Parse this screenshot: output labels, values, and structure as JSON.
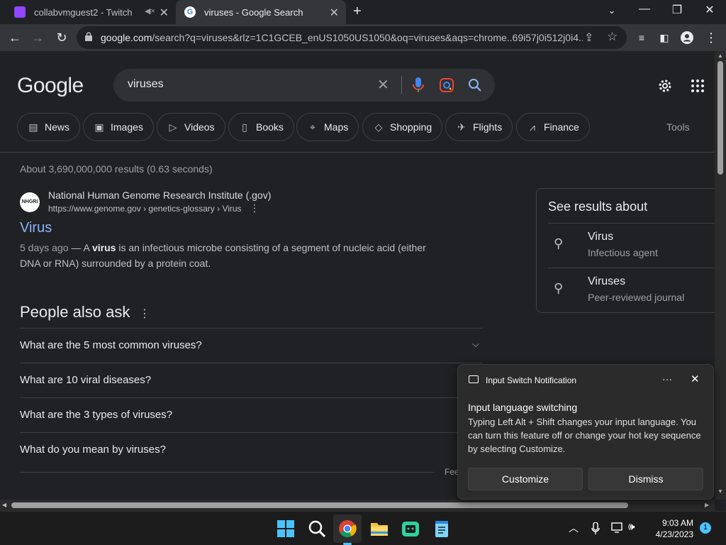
{
  "browser": {
    "tabs": [
      {
        "title": "collabvmguest2 - Twitch",
        "active": false
      },
      {
        "title": "viruses - Google Search",
        "active": true
      }
    ],
    "new_tab_icon": "plus-icon",
    "address": "google.com/search?q=viruses&rlz=1C1GCEB_enUS1050US1050&oq=viruses&aqs=chrome..69i57j0i512j0i4...",
    "address_domain": "google.com",
    "address_path": "/search?q=viruses&rlz=1C1GCEB_enUS1050US1050&oq=viruses&aqs=chrome..69i57j0i512j0i4..."
  },
  "google": {
    "logo": "Google",
    "query": "viruses",
    "chips": [
      {
        "label": "News",
        "icon": "news-icon"
      },
      {
        "label": "Images",
        "icon": "image-icon"
      },
      {
        "label": "Videos",
        "icon": "video-icon"
      },
      {
        "label": "Books",
        "icon": "book-icon"
      },
      {
        "label": "Maps",
        "icon": "map-pin-icon"
      },
      {
        "label": "Shopping",
        "icon": "tag-icon"
      },
      {
        "label": "Flights",
        "icon": "plane-icon"
      },
      {
        "label": "Finance",
        "icon": "finance-icon"
      }
    ],
    "tools": "Tools",
    "stats": "About 3,690,000,000 results (0.63 seconds)",
    "result": {
      "site": "National Human Genome Research Institute (.gov)",
      "url": "https://www.genome.gov › genetics-glossary › Virus",
      "title": "Virus",
      "date": "5 days ago",
      "snippet_pre": " — A ",
      "snippet_bold": "virus",
      "snippet_post": " is an infectious microbe consisting of a segment of nucleic acid (either DNA or RNA) surrounded by a protein coat."
    },
    "paa": {
      "title": "People also ask",
      "questions": [
        "What are the 5 most common viruses?",
        "What are 10 viral diseases?",
        "What are the 3 types of viruses?",
        "What do you mean by viruses?"
      ],
      "feedback": "Feedback"
    },
    "see_results": {
      "title": "See results about",
      "items": [
        {
          "name": "Virus",
          "desc": "Infectious agent"
        },
        {
          "name": "Viruses",
          "desc": "Peer-reviewed journal"
        }
      ]
    }
  },
  "toast": {
    "header": "Input Switch Notification",
    "title": "Input language switching",
    "body": "Typing Left Alt + Shift changes your input language. You can turn this feature off or change your hot key sequence by selecting Customize.",
    "customize": "Customize",
    "dismiss": "Dismiss",
    "more": "···",
    "close": "✕"
  },
  "taskbar": {
    "time": "9:03 AM",
    "date": "4/23/2023",
    "notifications": "1"
  },
  "colors": {
    "background": "#202124",
    "link": "#8ab4f8",
    "accent": "#4cc2ff"
  }
}
